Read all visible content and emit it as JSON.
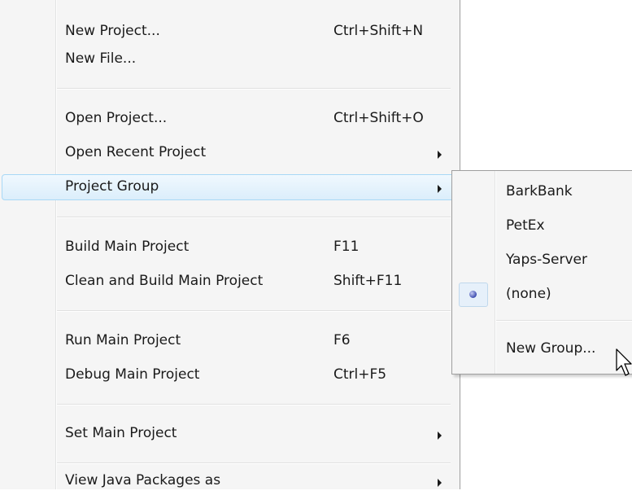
{
  "main_menu": {
    "items": [
      {
        "label": "New Project...",
        "shortcut": "Ctrl+Shift+N"
      },
      {
        "label": "New File...",
        "shortcut": ""
      },
      {
        "label": "Open Project...",
        "shortcut": "Ctrl+Shift+O"
      },
      {
        "label": "Open Recent Project",
        "shortcut": ""
      },
      {
        "label": "Project Group",
        "shortcut": ""
      },
      {
        "label": "Build Main Project",
        "shortcut": "F11"
      },
      {
        "label": "Clean and Build Main Project",
        "shortcut": "Shift+F11"
      },
      {
        "label": "Run Main Project",
        "shortcut": "F6"
      },
      {
        "label": "Debug Main Project",
        "shortcut": "Ctrl+F5"
      },
      {
        "label": "Set Main Project",
        "shortcut": ""
      },
      {
        "label": "View Java Packages as",
        "shortcut": ""
      }
    ]
  },
  "submenu": {
    "items": [
      {
        "label": "BarkBank"
      },
      {
        "label": "PetEx"
      },
      {
        "label": "Yaps-Server"
      },
      {
        "label": "(none)",
        "selected": true
      },
      {
        "label": "New Group..."
      }
    ]
  },
  "icons": {
    "submenu_arrow": "triangle-right",
    "radio": "radio-dot",
    "cursor": "arrow-pointer"
  },
  "colors": {
    "menu_bg": "#f5f5f5",
    "highlight_border": "#a8d8f6",
    "highlight_fill": "#dbeefb"
  }
}
